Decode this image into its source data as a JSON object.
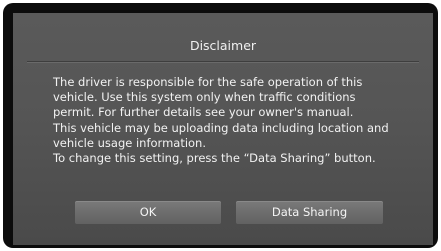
{
  "dialog": {
    "title": "Disclaimer",
    "body_lines": [
      "The driver is responsible for the safe operation of this",
      "vehicle. Use this system only when traffic conditions",
      "permit. For further details see your owner's manual.",
      "This vehicle may be uploading data including location and",
      "vehicle usage information.",
      "To change this setting, press the “Data Sharing” button."
    ],
    "ok_label": "OK",
    "data_sharing_label": "Data Sharing"
  },
  "colors": {
    "dialog_background": "#555555",
    "button_background": "#6d6d6d",
    "text": "#f2f2f2"
  }
}
